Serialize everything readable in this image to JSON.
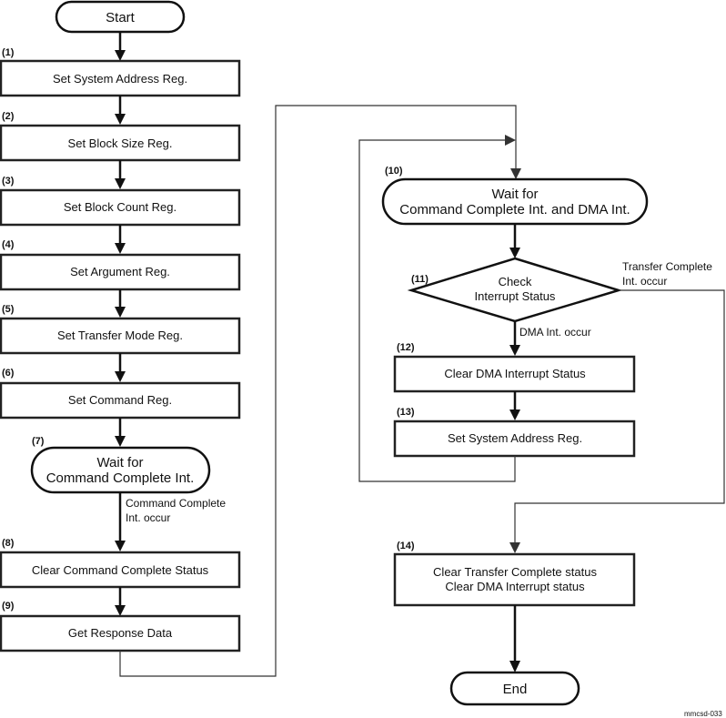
{
  "diagram": {
    "terminals": {
      "start": "Start",
      "end": "End"
    },
    "steps": [
      {
        "num": "(1)",
        "text": "Set System Address Reg."
      },
      {
        "num": "(2)",
        "text": "Set Block Size Reg."
      },
      {
        "num": "(3)",
        "text": "Set Block Count Reg."
      },
      {
        "num": "(4)",
        "text": "Set Argument Reg."
      },
      {
        "num": "(5)",
        "text": "Set Transfer Mode Reg."
      },
      {
        "num": "(6)",
        "text": "Set Command Reg."
      },
      {
        "num": "(7)",
        "line1": "Wait for",
        "line2": "Command Complete Int."
      },
      {
        "num": "(8)",
        "text": "Clear Command Complete Status"
      },
      {
        "num": "(9)",
        "text": "Get Response Data"
      },
      {
        "num": "(10)",
        "line1": "Wait for",
        "line2": "Command Complete Int. and DMA Int."
      },
      {
        "num": "(11)",
        "line1": "Check",
        "line2": "Interrupt Status"
      },
      {
        "num": "(12)",
        "text": "Clear DMA Interrupt Status"
      },
      {
        "num": "(13)",
        "text": "Set System Address Reg."
      },
      {
        "num": "(14)",
        "line1": "Clear Transfer Complete status",
        "line2": "Clear DMA Interrupt status"
      }
    ],
    "edge_labels": {
      "cmd_complete_line1": "Command Complete",
      "cmd_complete_line2": "Int. occur",
      "transfer_complete_line1": "Transfer Complete",
      "transfer_complete_line2": "Int. occur",
      "dma_occur": "DMA Int. occur"
    },
    "figure_id": "mmcsd-033"
  }
}
